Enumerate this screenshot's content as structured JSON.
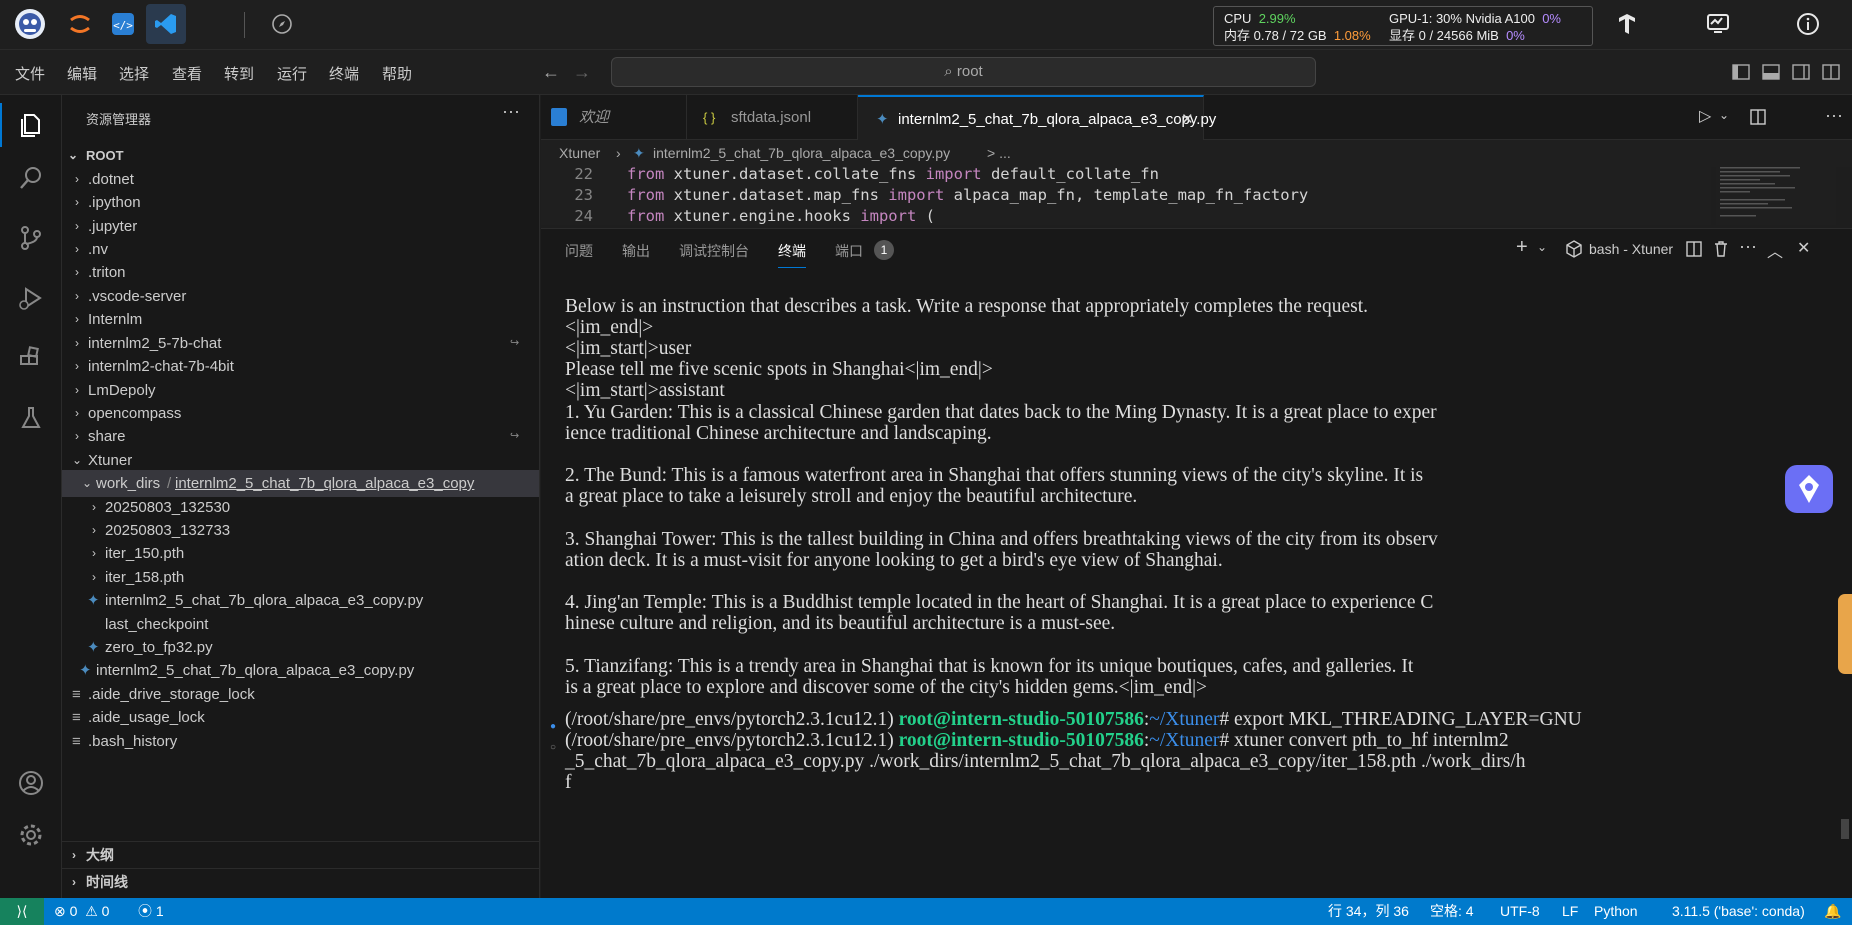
{
  "topbar": {
    "stats": {
      "cpu_label": "CPU",
      "cpu_value": "2.99%",
      "mem_label": "内存 0.78 / 72 GB",
      "mem_value": "1.08%",
      "gpu_label": "GPU-1: 30% Nvidia A100",
      "gpu_value": "0%",
      "vram_label": "显存 0 / 24566 MiB",
      "vram_value": "0%"
    }
  },
  "menubar": {
    "items": [
      "文件",
      "编辑",
      "选择",
      "查看",
      "转到",
      "运行",
      "终端",
      "帮助"
    ],
    "search": "root"
  },
  "sidebar": {
    "title": "资源管理器",
    "root": "ROOT",
    "items": [
      {
        "label": ".dotnet"
      },
      {
        "label": ".ipython"
      },
      {
        "label": ".jupyter"
      },
      {
        "label": ".nv"
      },
      {
        "label": ".triton"
      },
      {
        "label": ".vscode-server"
      },
      {
        "label": "Internlm"
      },
      {
        "label": "internlm2_5-7b-chat"
      },
      {
        "label": "internlm2-chat-7b-4bit"
      },
      {
        "label": "LmDepoly"
      },
      {
        "label": "opencompass"
      },
      {
        "label": "share"
      },
      {
        "label": "Xtuner"
      },
      {
        "label_a": "work_dirs",
        "label_b": "internlm2_5_chat_7b_qlora_alpaca_e3_copy"
      },
      {
        "label": "20250803_132530"
      },
      {
        "label": "20250803_132733"
      },
      {
        "label": "iter_150.pth"
      },
      {
        "label": "iter_158.pth"
      },
      {
        "label": "internlm2_5_chat_7b_qlora_alpaca_e3_copy.py"
      },
      {
        "label": "last_checkpoint"
      },
      {
        "label": "zero_to_fp32.py"
      },
      {
        "label": "internlm2_5_chat_7b_qlora_alpaca_e3_copy.py"
      },
      {
        "label": ".aide_drive_storage_lock"
      },
      {
        "label": ".aide_usage_lock"
      },
      {
        "label": ".bash_history"
      }
    ],
    "outline": "大纲",
    "timeline": "时间线"
  },
  "tabs": [
    {
      "label": "欢迎"
    },
    {
      "label": "sftdata.jsonl"
    },
    {
      "label": "internlm2_5_chat_7b_qlora_alpaca_e3_copy.py"
    }
  ],
  "breadcrumb": {
    "folder": "Xtuner",
    "file": "internlm2_5_chat_7b_qlora_alpaca_e3_copy.py",
    "tail": "> ..."
  },
  "code": [
    {
      "n": "22",
      "a": "from",
      "b": " xtuner.dataset.collate_fns ",
      "c": "import",
      "d": " default_collate_fn"
    },
    {
      "n": "23",
      "a": "from",
      "b": " xtuner.dataset.map_fns ",
      "c": "import",
      "d": " alpaca_map_fn, template_map_fn_factory"
    },
    {
      "n": "24",
      "a": "from",
      "b": " xtuner.engine.hooks ",
      "c": "import",
      "d": " ("
    }
  ],
  "panel": {
    "tabs": [
      "问题",
      "输出",
      "调试控制台",
      "终端",
      "端口"
    ],
    "ports_badge": "1",
    "terminal_name": "bash - Xtuner"
  },
  "terminal": {
    "lines": [
      "Below is an instruction that describes a task. Write a response that appropriately completes the request.",
      "<|im_end|>",
      "<|im_start|>user",
      "Please tell me five scenic spots in Shanghai<|im_end|>",
      "<|im_start|>assistant",
      "1. Yu Garden: This is a classical Chinese garden that dates back to the Ming Dynasty. It is a great place to exper",
      "ience traditional Chinese architecture and landscaping.",
      "",
      "2. The Bund: This is a famous waterfront area in Shanghai that offers stunning views of the city's skyline. It is",
      "a great place to take a leisurely stroll and enjoy the beautiful architecture.",
      "",
      "3. Shanghai Tower: This is the tallest building in China and offers breathtaking views of the city from its observ",
      "ation deck. It is a must-visit for anyone looking to get a bird's eye view of Shanghai.",
      "",
      "4. Jing'an Temple: This is a Buddhist temple located in the heart of Shanghai. It is a great place to experience C",
      "hinese culture and religion, and its beautiful architecture is a must-see.",
      "",
      "5. Tianzifang: This is a trendy area in Shanghai that is known for its unique boutiques, cafes, and galleries. It",
      "is a great place to explore and discover some of the city's hidden gems.<|im_end|>"
    ],
    "prompt_env": "(/root/share/pre_envs/pytorch2.3.1cu12.1) ",
    "prompt_user": "root@intern-studio-50107586",
    "prompt_sep": ":",
    "prompt_path": "~/Xtuner",
    "prompt_end": "# ",
    "cmd1": "export MKL_THREADING_LAYER=GNU",
    "cmd2_a": "xtuner convert pth_to_hf internlm2",
    "cmd2_b": "_5_chat_7b_qlora_alpaca_e3_copy.py ./work_dirs/internlm2_5_chat_7b_qlora_alpaca_e3_copy/iter_158.pth ./work_dirs/h",
    "cmd2_c": "f"
  },
  "statusbar": {
    "errors": "0",
    "warnings": "0",
    "ports": "1",
    "position": "行 34，列 36",
    "spaces": "空格: 4",
    "encoding": "UTF-8",
    "eol": "LF",
    "language": "Python",
    "interpreter": "3.11.5 ('base': conda)"
  },
  "colors": {
    "accent": "#007acc",
    "remote": "#16825d",
    "prompt_green": "#23d18b",
    "prompt_blue": "#3b8eea"
  }
}
